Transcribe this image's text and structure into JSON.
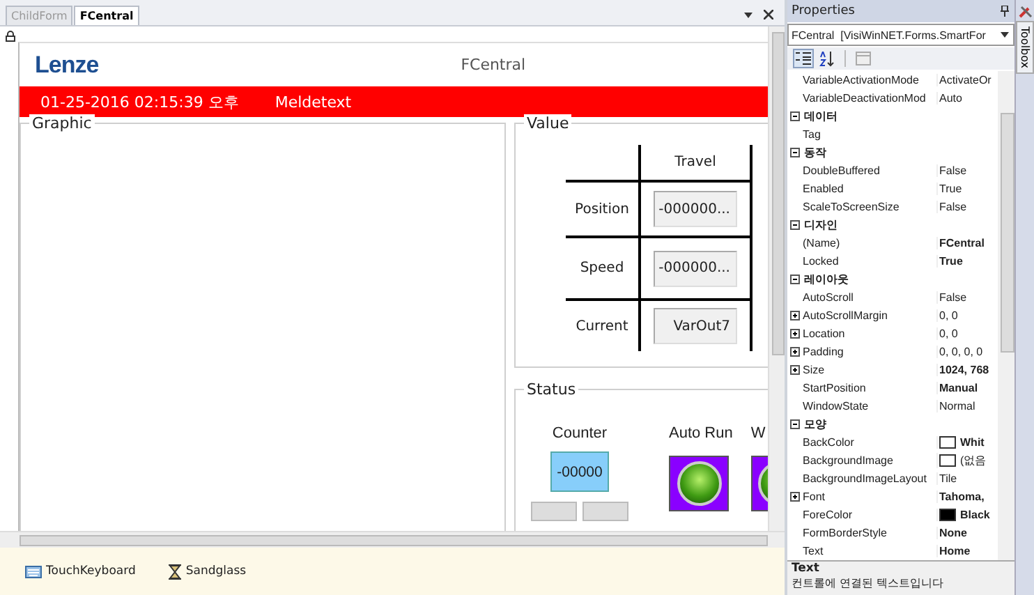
{
  "tabs": [
    {
      "label": "ChildForm",
      "selected": false
    },
    {
      "label": "FCentral",
      "selected": true
    }
  ],
  "form": {
    "logo": "Lenze",
    "title": "FCentral",
    "alarm": {
      "timestamp": "01-25-2016 02:15:39 오후",
      "message": "Meldetext"
    },
    "graphic": {
      "title": "Graphic"
    },
    "value": {
      "title": "Value",
      "column": "Travel",
      "rows": [
        {
          "label": "Position",
          "value": "-000000..."
        },
        {
          "label": "Speed",
          "value": "-000000..."
        },
        {
          "label": "Current",
          "value": "VarOut7"
        }
      ]
    },
    "status": {
      "title": "Status",
      "counter": {
        "label": "Counter",
        "value": "-00000"
      },
      "indicators": [
        {
          "label": "Auto Run",
          "on": true
        },
        {
          "label": "W",
          "on": true
        }
      ]
    }
  },
  "tray": [
    {
      "label": "TouchKeyboard",
      "kind": "keyboard"
    },
    {
      "label": "Sandglass",
      "kind": "sandglass"
    }
  ],
  "properties": {
    "title": "Properties",
    "object": "FCentral  [VisiWinNET.Forms.SmartFor",
    "toolbar": [
      {
        "kind": "categorized",
        "selected": true
      },
      {
        "kind": "alphabetical",
        "selected": false
      },
      {
        "kind": "pages",
        "selected": false
      }
    ],
    "rows": [
      {
        "kind": "property",
        "name": "VariableActivationMode",
        "value": "ActivateOr",
        "modified": false,
        "expandable": false
      },
      {
        "kind": "property",
        "name": "VariableDeactivationMod",
        "value": "Auto",
        "modified": false,
        "expandable": false
      },
      {
        "kind": "category",
        "label": "데이터",
        "expanded": true
      },
      {
        "kind": "property",
        "name": "Tag",
        "expandable": false
      },
      {
        "kind": "category",
        "label": "동작",
        "expanded": true
      },
      {
        "kind": "property",
        "name": "DoubleBuffered",
        "value": "False",
        "modified": false,
        "expandable": false
      },
      {
        "kind": "property",
        "name": "Enabled",
        "value": "True",
        "modified": false,
        "expandable": false
      },
      {
        "kind": "property",
        "name": "ScaleToScreenSize",
        "value": "False",
        "modified": false,
        "expandable": false
      },
      {
        "kind": "category",
        "label": "디자인",
        "expanded": true
      },
      {
        "kind": "property",
        "name": "(Name)",
        "value": "FCentral",
        "modified": true,
        "expandable": false
      },
      {
        "kind": "property",
        "name": "Locked",
        "value": "True",
        "modified": true,
        "expandable": false
      },
      {
        "kind": "category",
        "label": "레이아웃",
        "expanded": true
      },
      {
        "kind": "property",
        "name": "AutoScroll",
        "value": "False",
        "modified": false,
        "expandable": false
      },
      {
        "kind": "property",
        "name": "AutoScrollMargin",
        "value": "0, 0",
        "modified": false,
        "expandable": true
      },
      {
        "kind": "property",
        "name": "Location",
        "value": "0, 0",
        "modified": false,
        "expandable": true
      },
      {
        "kind": "property",
        "name": "Padding",
        "value": "0, 0, 0, 0",
        "modified": false,
        "expandable": true
      },
      {
        "kind": "property",
        "name": "Size",
        "value": "1024, 768",
        "modified": true,
        "expandable": true
      },
      {
        "kind": "property",
        "name": "StartPosition",
        "value": "Manual",
        "modified": true,
        "expandable": false
      },
      {
        "kind": "property",
        "name": "WindowState",
        "value": "Normal",
        "modified": false,
        "expandable": false
      },
      {
        "kind": "category",
        "label": "모양",
        "expanded": true
      },
      {
        "kind": "property",
        "name": "BackColor",
        "value": "Whit",
        "modified": true,
        "expandable": false,
        "color": "#ffffff"
      },
      {
        "kind": "property",
        "name": "BackgroundImage",
        "value": "(없음",
        "modified": false,
        "expandable": false,
        "color": "#ffffff"
      },
      {
        "kind": "property",
        "name": "BackgroundImageLayout",
        "value": "Tile",
        "modified": false,
        "expandable": false
      },
      {
        "kind": "property",
        "name": "Font",
        "value": "Tahoma,",
        "modified": true,
        "expandable": true
      },
      {
        "kind": "property",
        "name": "ForeColor",
        "value": "Black",
        "modified": true,
        "expandable": false,
        "color": "#000000"
      },
      {
        "kind": "property",
        "name": "FormBorderStyle",
        "value": "None",
        "modified": true,
        "expandable": false
      },
      {
        "kind": "property",
        "name": "Text",
        "value": "Home",
        "modified": true,
        "expandable": false
      }
    ],
    "description": {
      "title": "Text",
      "text": "컨트롤에 연결된 텍스트입니다"
    }
  },
  "toolbox": {
    "label": "Toolbox"
  }
}
